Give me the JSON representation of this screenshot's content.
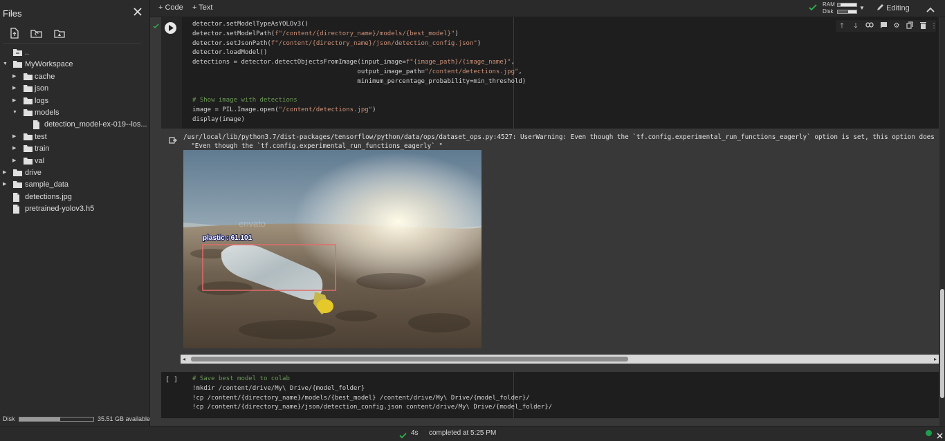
{
  "sidebar": {
    "title": "Files",
    "parent_label": "..",
    "tree": [
      {
        "label": "MyWorkspace",
        "type": "folder",
        "depth": 0,
        "expanded": true
      },
      {
        "label": "cache",
        "type": "folder",
        "depth": 1,
        "expanded": false
      },
      {
        "label": "json",
        "type": "folder",
        "depth": 1,
        "expanded": false
      },
      {
        "label": "logs",
        "type": "folder",
        "depth": 1,
        "expanded": false
      },
      {
        "label": "models",
        "type": "folder",
        "depth": 1,
        "expanded": true
      },
      {
        "label": "detection_model-ex-019--los...",
        "type": "file",
        "depth": 2
      },
      {
        "label": "test",
        "type": "folder",
        "depth": 1,
        "expanded": false
      },
      {
        "label": "train",
        "type": "folder",
        "depth": 1,
        "expanded": false
      },
      {
        "label": "val",
        "type": "folder",
        "depth": 1,
        "expanded": false
      },
      {
        "label": "drive",
        "type": "folder",
        "depth": 0,
        "expanded": false
      },
      {
        "label": "sample_data",
        "type": "folder",
        "depth": 0,
        "expanded": false
      },
      {
        "label": "detections.jpg",
        "type": "file",
        "depth": 0
      },
      {
        "label": "pretrained-yolov3.h5",
        "type": "file",
        "depth": 0
      }
    ],
    "disk": {
      "label": "Disk",
      "used_fraction": 0.55,
      "available": "35.51 GB available"
    }
  },
  "topbar": {
    "code_button": "+ Code",
    "text_button": "+ Text",
    "ram_label": "RAM",
    "disk_label": "Disk",
    "ram_fraction": 0.15,
    "disk_fraction": 0.55,
    "editing_label": "Editing"
  },
  "cell1": {
    "lines": [
      "detector.setModelTypeAsYOLOv3()",
      "detector.setModelPath(f\"/content/{directory_name}/models/{best_model}\")",
      "detector.setJsonPath(f\"/content/{directory_name}/json/detection_config.json\")",
      "detector.loadModel()",
      "detections = detector.detectObjectsFromImage(input_image=f\"{image_path}/{image_name}\",",
      "                                            output_image_path=\"/content/detections.jpg\",",
      "                                            minimum_percentage_probability=min_threshold)",
      "",
      "# Show image with detections",
      "image = PIL.Image.open(\"/content/detections.jpg\")",
      "display(image)"
    ],
    "output_warning": "/usr/local/lib/python3.7/dist-packages/tensorflow/python/data/ops/dataset_ops.py:4527: UserWarning: Even though the `tf.config.experimental_run_functions_eagerly` option is set, this option does",
    "output_warning_line2": "  \"Even though the `tf.config.experimental_run_functions_eagerly` \"",
    "detection_label": "plastic : 61.101",
    "watermark": "envato"
  },
  "cell2": {
    "execution_label": "[ ]",
    "lines": [
      "# Save best model to colab",
      "!mkdir /content/drive/My\\ Drive/{model_folder}",
      "!cp /content/{directory_name}/models/{best_model} /content/drive/My\\ Drive/{model_folder}/",
      "!cp /content/{directory_name}/json/detection_config.json content/drive/My\\ Drive/{model_folder}/"
    ]
  },
  "statusbar": {
    "elapsed": "4s",
    "completed": "completed at 5:25 PM"
  },
  "colors": {
    "background": "#383838",
    "cell": "#1e1e1e",
    "string": "#ce9178",
    "comment": "#6a9955",
    "status_ok": "#1e9e4a"
  }
}
